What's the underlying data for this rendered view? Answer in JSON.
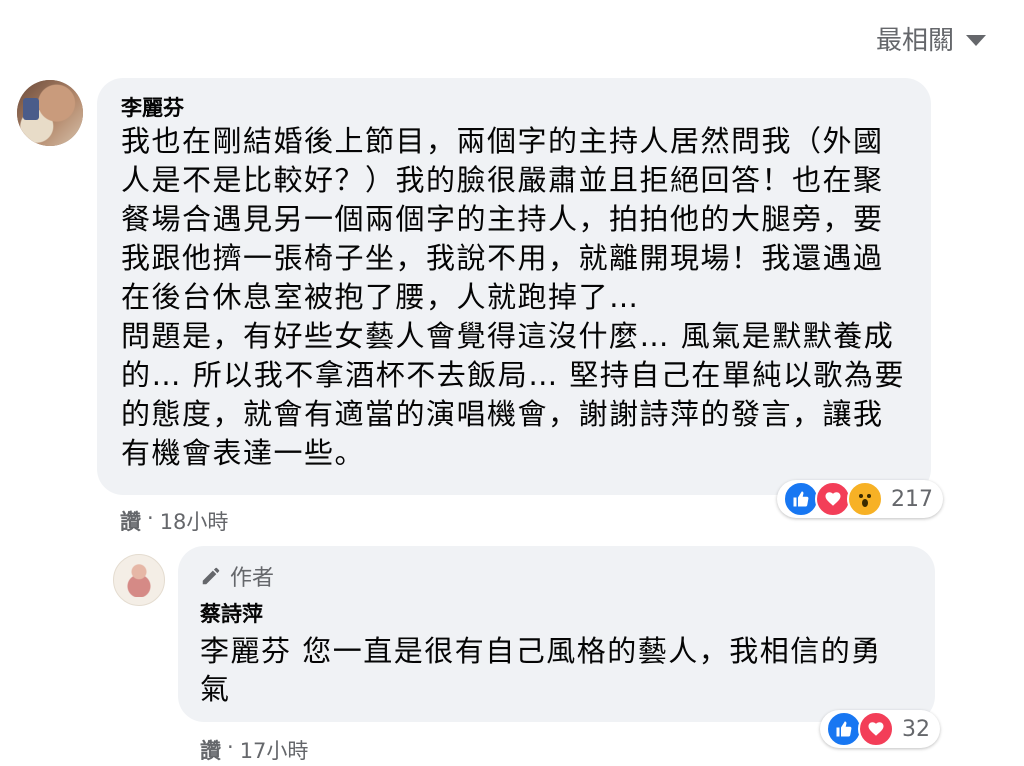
{
  "sort": {
    "label": "最相關"
  },
  "comments": [
    {
      "author": "李麗芬",
      "lines": [
        "我也在剛結婚後上節目，兩個字的主持人居然問我（外國",
        "人是不是比較好？）我的臉很嚴肅並且拒絕回答！也在聚",
        "餐場合遇見另一個兩個字的主持人，拍拍他的大腿旁，要",
        "我跟他擠一張椅子坐，我說不用，就離開現場！我還遇過",
        "在後台休息室被抱了腰，人就跑掉了…",
        "問題是，有好些女藝人會覺得這沒什麼… 風氣是默默養成",
        "的… 所以我不拿酒杯不去飯局… 堅持自己在單純以歌為要",
        "的態度，就會有適當的演唱機會，謝謝詩萍的發言，讓我",
        "有機會表達一些。"
      ],
      "like_label": "讚",
      "time": "18小時",
      "reaction_count": "217"
    },
    {
      "author_badge": "作者",
      "author": "蔡詩萍",
      "lines": [
        "李麗芬 您一直是很有自己風格的藝人，我相信的勇",
        "氣"
      ],
      "like_label": "讚",
      "time": "17小時",
      "reaction_count": "32"
    }
  ],
  "separator": "·",
  "colors": {
    "bubble": "#f0f2f5",
    "muted": "#65676b",
    "like": "#1877f2",
    "love": "#f33e58",
    "wow": "#f7b125"
  }
}
